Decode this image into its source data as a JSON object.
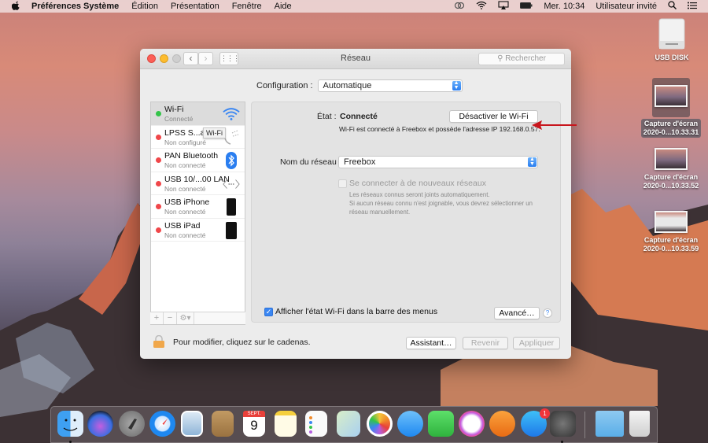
{
  "menubar": {
    "apple": "",
    "app_name": "Préférences Système",
    "menus": [
      "Édition",
      "Présentation",
      "Fenêtre",
      "Aide"
    ],
    "clock": "Mer. 10:34",
    "user": "Utilisateur invité"
  },
  "window": {
    "title": "Réseau",
    "search_placeholder": "Rechercher",
    "grid_glyph": "⋮⋮⋮",
    "back_glyph": "‹",
    "forward_glyph": "›",
    "configuration_label": "Configuration :",
    "configuration_value": "Automatique",
    "services": [
      {
        "name": "Wi-Fi",
        "status": "Connecté",
        "status_color": "#34c449",
        "icon": "wifi-icon",
        "selected": true
      },
      {
        "name": "LPSS S...apt",
        "status": "Non configuré",
        "status_color": "#f0474a",
        "icon": "phone-serial-icon",
        "selected": false
      },
      {
        "name": "PAN Bluetooth",
        "status": "Non connecté",
        "status_color": "#f0474a",
        "icon": "bluetooth-icon",
        "selected": false
      },
      {
        "name": "USB 10/...00 LAN",
        "status": "Non connecté",
        "status_color": "#f0474a",
        "icon": "ethernet-icon",
        "selected": false
      },
      {
        "name": "USB iPhone",
        "status": "Non connecté",
        "status_color": "#f0474a",
        "icon": "iphone-icon",
        "selected": false
      },
      {
        "name": "USB iPad",
        "status": "Non connecté",
        "status_color": "#f0474a",
        "icon": "ipad-icon",
        "selected": false
      }
    ],
    "tooltip": "Wi-Fi",
    "sidebar_tools": {
      "add": "+",
      "remove": "−",
      "gear": "⚙▾"
    },
    "status_label": "État :",
    "status_value": "Connecté",
    "disable_wifi_button": "Désactiver le Wi-Fi",
    "status_description": "Wi-Fi est connecté à Freebox et possède l'adresse IP 192.168.0.57.",
    "network_name_label": "Nom du réseau :",
    "network_name_value": "Freebox",
    "auto_join_label": "Se connecter à de nouveaux réseaux",
    "auto_join_checked": false,
    "auto_join_description_1": "Les réseaux connus seront joints automatiquement.",
    "auto_join_description_2": "Si aucun réseau connu n'est joignable, vous devrez sélectionner un réseau manuellement.",
    "show_wifi_status_label": "Afficher l'état Wi-Fi dans la barre des menus",
    "show_wifi_status_checked": true,
    "advanced_button": "Avancé…",
    "help_glyph": "?",
    "lock_text": "Pour modifier, cliquez sur le cadenas.",
    "assistant_button": "Assistant…",
    "revert_button": "Revenir",
    "apply_button": "Appliquer"
  },
  "desktop_icons": [
    {
      "label": "USB DISK"
    },
    {
      "label_1": "Capture d'écran",
      "label_2": "2020-0...10.33.31",
      "selected": true
    },
    {
      "label_1": "Capture d'écran",
      "label_2": "2020-0...10.33.52"
    },
    {
      "label_1": "Capture d'écran",
      "label_2": "2020-0...10.33.59"
    }
  ],
  "dock": {
    "calendar_month": "SEPT.",
    "calendar_day": "9",
    "app_store_badge": "1",
    "apps": [
      "Finder",
      "Siri",
      "Launchpad",
      "Safari",
      "Mail",
      "Contacts",
      "Calendrier",
      "Notes",
      "Rappels",
      "Plans",
      "Photos",
      "Messages",
      "FaceTime",
      "iTunes",
      "iBooks",
      "App Store",
      "Préférences Système",
      "Téléchargements",
      "Corbeille"
    ]
  },
  "colors": {
    "accent": "#3a86f2",
    "connected": "#34c449",
    "disconnected": "#f0474a",
    "annotation_arrow": "#c8161d"
  }
}
